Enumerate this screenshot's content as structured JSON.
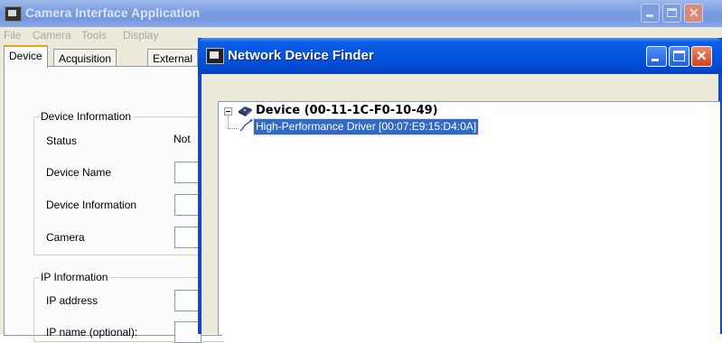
{
  "main_window": {
    "title": "Camera Interface Application",
    "menu": [
      "File",
      "Camera",
      "Tools",
      "Display"
    ],
    "tabs": [
      "Device",
      "Acquisition",
      "External"
    ],
    "device_info": {
      "group_title": "Device Information",
      "status_label": "Status",
      "status_value": "Not",
      "device_name_label": "Device Name",
      "device_information_label": "Device Information",
      "camera_label": "Camera"
    },
    "ip_info": {
      "group_title": "IP Information",
      "ip_address_label": "IP address",
      "ip_name_label": "IP name (optional):"
    }
  },
  "dialog": {
    "title": "Network Device Finder",
    "tree": {
      "device_label": "Device (00-11-1C-F0-10-49)",
      "driver_label": "High-Performance Driver [00:07:E9:15:D4:0A]"
    }
  },
  "colors": {
    "titlebar_active": "#0054e3",
    "titlebar_inactive": "#7a9be0",
    "selection": "#316ac5",
    "face": "#ece9d8"
  }
}
